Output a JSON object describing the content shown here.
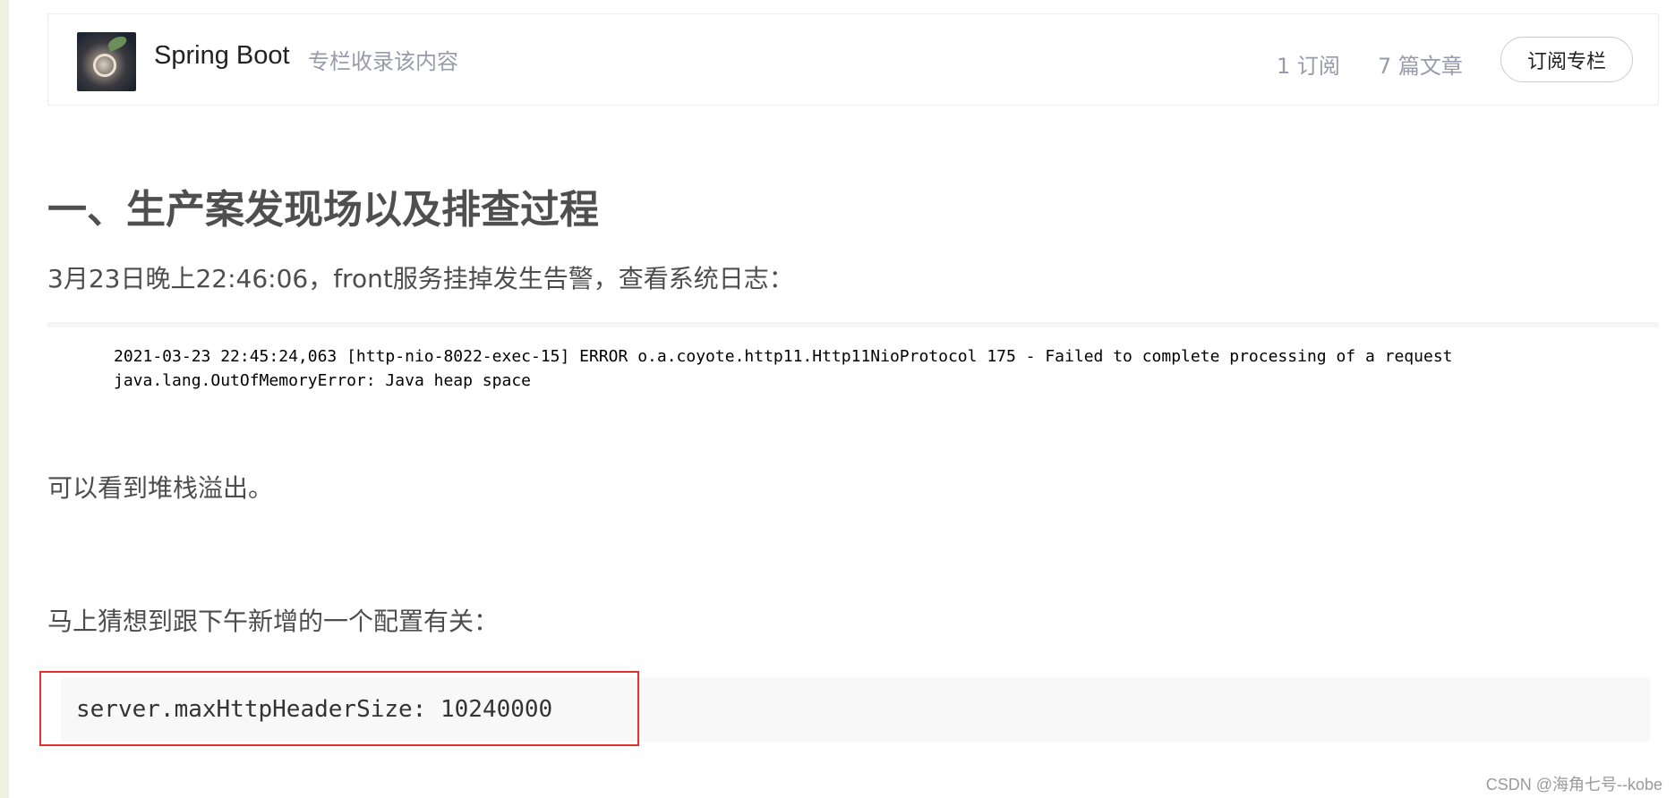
{
  "column": {
    "cover_icon": "spring-boot-column-cover",
    "title": "Spring Boot",
    "subtitle": "专栏收录该内容",
    "subscribers": "1 订阅",
    "articles": "7 篇文章",
    "subscribe_label": "订阅专栏"
  },
  "article": {
    "heading": "一、生产案发现场以及排查过程",
    "para_1": "3月23日晚上22:46:06，front服务挂掉发生告警，查看系统日志：",
    "log_lines": [
      "2021-03-23 22:45:24,063 [http-nio-8022-exec-15] ERROR o.a.coyote.http11.Http11NioProtocol 175 - Failed to complete processing of a request",
      "java.lang.OutOfMemoryError: Java heap space"
    ],
    "para_2": "可以看到堆栈溢出。",
    "para_3": "马上猜想到跟下午新增的一个配置有关：",
    "config_code": "server.maxHttpHeaderSize: 10240000"
  },
  "watermark": "CSDN @海角七号--kobe",
  "colors": {
    "highlight_border": "#e0312f",
    "muted_text": "#999aaa",
    "body_text": "#4d4d4d"
  }
}
